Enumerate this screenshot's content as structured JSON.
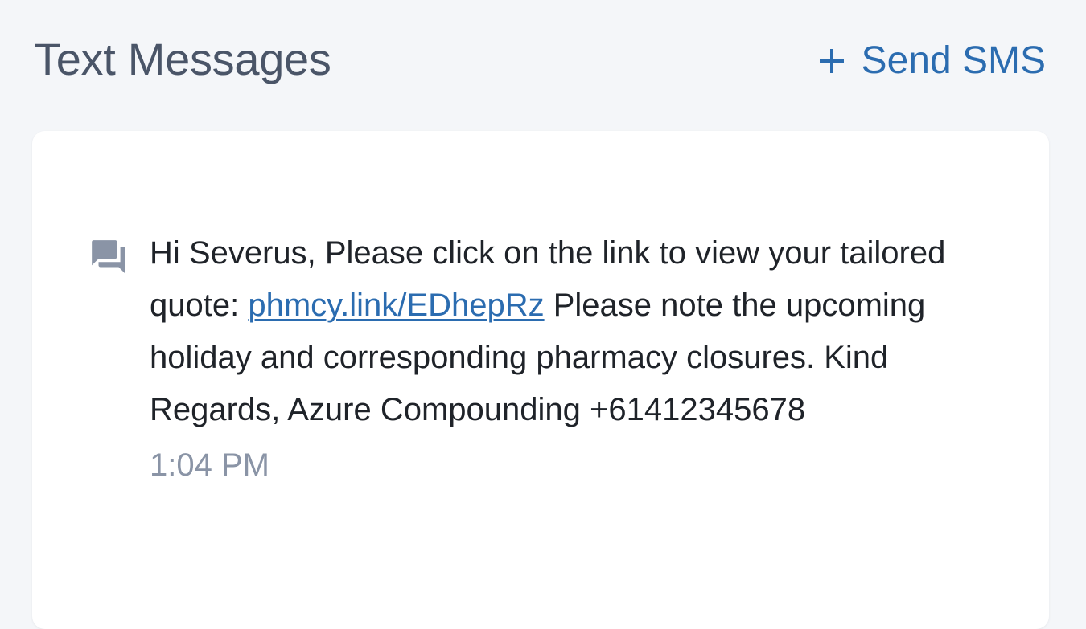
{
  "header": {
    "title": "Text Messages",
    "send_label": "Send SMS"
  },
  "message": {
    "icon": "forum-icon",
    "text_before_link": "Hi Severus, Please click on the link to view your tailored quote: ",
    "link_text": "phmcy.link/EDhepRz",
    "text_after_link": " Please note the upcoming holiday and corresponding pharmacy closures. Kind Regards, Azure Compounding +61412345678",
    "time": "1:04 PM"
  },
  "colors": {
    "background": "#f4f6f9",
    "card": "#ffffff",
    "title": "#4a5568",
    "accent": "#2b6cb0",
    "icon": "#8a94a6",
    "time": "#8a94a6"
  }
}
